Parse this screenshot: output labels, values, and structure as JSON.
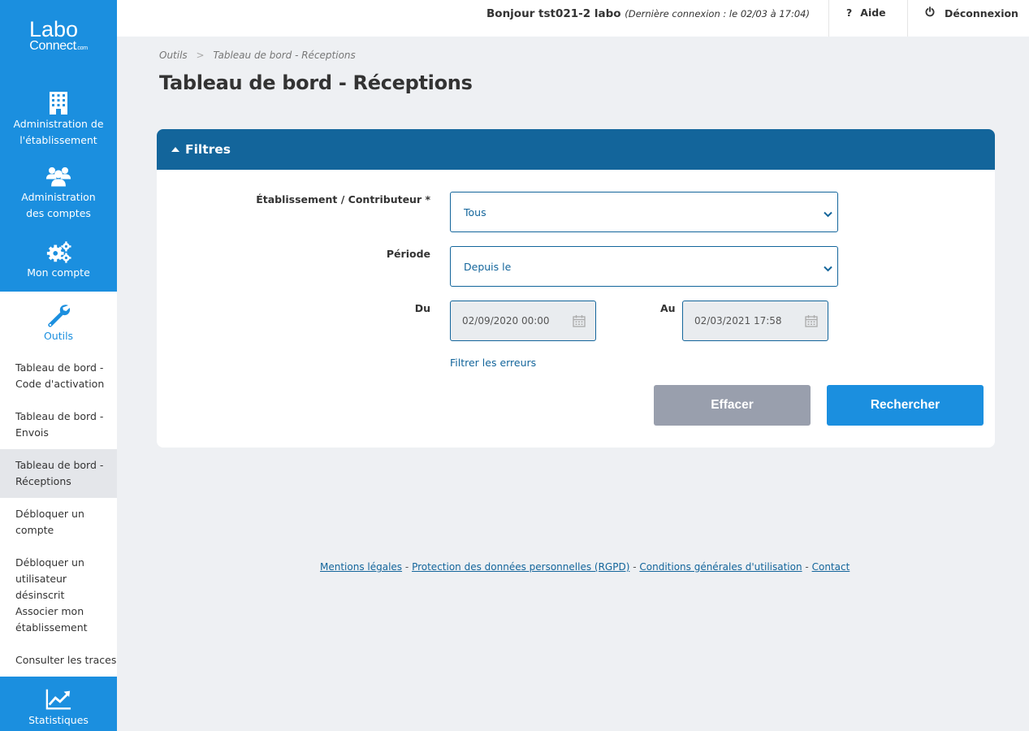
{
  "logo": {
    "line1": "Labo",
    "line2": "Connect",
    "suffix": ".com"
  },
  "sidebar": {
    "admin_etablissement": {
      "line1": "Administration de",
      "line2": "l'établissement",
      "icon": "building-icon"
    },
    "admin_comptes": {
      "line1": "Administration",
      "line2": "des comptes",
      "icon": "users-icon"
    },
    "mon_compte": {
      "line1": "Mon compte",
      "icon": "gears-icon"
    },
    "outils": {
      "label": "Outils",
      "icon": "wrench-icon"
    },
    "sub_items": [
      {
        "line1": "Tableau de bord -",
        "line2": "Code d'activation"
      },
      {
        "line1": "Tableau de bord -",
        "line2": "Envois"
      },
      {
        "line1": "Tableau de bord -",
        "line2": "Réceptions"
      },
      {
        "line1": "Débloquer un",
        "line2": "compte"
      },
      {
        "line1": "Débloquer un",
        "line2": "utilisateur désinscrit"
      },
      {
        "line1": "Associer mon",
        "line2": "établissement"
      },
      {
        "line1": "Consulter les traces",
        "line2": ""
      }
    ],
    "statistiques": {
      "label": "Statistiques",
      "icon": "chart-up-icon"
    }
  },
  "topbar": {
    "greeting": "Bonjour tst021-2 labo",
    "last_login": "(Dernière connexion : le 02/03 à 17:04)",
    "help_label": "Aide",
    "logout_label": "Déconnexion"
  },
  "breadcrumb": {
    "root": "Outils",
    "separator": ">",
    "current": "Tableau de bord - Réceptions"
  },
  "page_title": "Tableau de bord - Réceptions",
  "filters": {
    "header": "Filtres",
    "etablissement_label": "Établissement / Contributeur *",
    "etablissement_value": "Tous",
    "periode_label": "Période",
    "periode_value": "Depuis le",
    "du_label": "Du",
    "du_value": "02/09/2020 00:00",
    "au_label": "Au",
    "au_value": "02/03/2021 17:58",
    "errors_link": "Filtrer les erreurs",
    "clear_button": "Effacer",
    "search_button": "Rechercher"
  },
  "footer": {
    "mentions": "Mentions légales",
    "rgpd": "Protection des données personnelles (RGPD)",
    "cgu": "Conditions générales d'utilisation",
    "contact": "Contact",
    "separator": "-"
  },
  "colors": {
    "primary": "#1b8fdf",
    "dark_primary": "#13659b",
    "clear_button": "#999fad",
    "background": "#eef0f3"
  }
}
